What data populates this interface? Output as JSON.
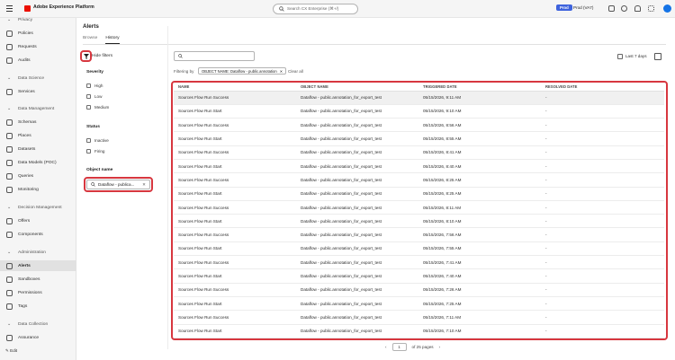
{
  "app": {
    "name": "Adobe Experience Platform",
    "search_placeholder": "Search CX Enterprise (⌘+/)",
    "env_badge": "Prod",
    "sandbox": "Prod (VA7)"
  },
  "sidebar": {
    "items": [
      {
        "label": "Privacy",
        "type": "section"
      },
      {
        "label": "Policies",
        "type": "item"
      },
      {
        "label": "Requests",
        "type": "item"
      },
      {
        "label": "Audits",
        "type": "item"
      },
      {
        "label": "Data Science",
        "type": "section"
      },
      {
        "label": "Services",
        "type": "item"
      },
      {
        "label": "Data Management",
        "type": "section"
      },
      {
        "label": "Schemas",
        "type": "item"
      },
      {
        "label": "Places",
        "type": "item"
      },
      {
        "label": "Datasets",
        "type": "item"
      },
      {
        "label": "Data Models (POC)",
        "type": "item"
      },
      {
        "label": "Queries",
        "type": "item"
      },
      {
        "label": "Monitoring",
        "type": "item"
      },
      {
        "label": "Decision Management",
        "type": "section"
      },
      {
        "label": "Offers",
        "type": "item"
      },
      {
        "label": "Components",
        "type": "item"
      },
      {
        "label": "Administration",
        "type": "section"
      },
      {
        "label": "Alerts",
        "type": "item",
        "active": true
      },
      {
        "label": "Sandboxes",
        "type": "item"
      },
      {
        "label": "Permissions",
        "type": "item"
      },
      {
        "label": "Tags",
        "type": "item"
      },
      {
        "label": "Data Collection",
        "type": "section"
      },
      {
        "label": "Assurance",
        "type": "item"
      }
    ],
    "edit": "Edit"
  },
  "page": {
    "title": "Alerts",
    "tabs": [
      "Browse",
      "History"
    ],
    "active_tab": "History"
  },
  "filters": {
    "hide_label": "Hide filters",
    "severity": {
      "title": "Severity",
      "options": [
        "High",
        "Low",
        "Medium"
      ]
    },
    "status": {
      "title": "Status",
      "options": [
        "Inactive",
        "Firing"
      ]
    },
    "object_name": {
      "title": "Object name",
      "value": "Dataflow - publica..."
    }
  },
  "toolbar": {
    "filtering_by": "Filtering by",
    "tag": "OBJECT NAME: Dataflow - public.annotation",
    "clear_all": "Clear all",
    "date_range": "Last 7 days"
  },
  "table": {
    "columns": [
      "NAME",
      "OBJECT NAME",
      "TRIGGERED DATE",
      "RESOLVED DATE"
    ],
    "rows": [
      [
        "Sources Flow Run Success",
        "Dataflow - public.annotation_for_export_test",
        "05/15/2026, 9:11 AM",
        "-"
      ],
      [
        "Sources Flow Run Start",
        "Dataflow - public.annotation_for_export_test",
        "05/15/2026, 9:10 AM",
        "-"
      ],
      [
        "Sources Flow Run Success",
        "Dataflow - public.annotation_for_export_test",
        "05/15/2026, 8:56 AM",
        "-"
      ],
      [
        "Sources Flow Run Start",
        "Dataflow - public.annotation_for_export_test",
        "05/15/2026, 8:55 AM",
        "-"
      ],
      [
        "Sources Flow Run Success",
        "Dataflow - public.annotation_for_export_test",
        "05/15/2026, 8:41 AM",
        "-"
      ],
      [
        "Sources Flow Run Start",
        "Dataflow - public.annotation_for_export_test",
        "05/15/2026, 8:40 AM",
        "-"
      ],
      [
        "Sources Flow Run Success",
        "Dataflow - public.annotation_for_export_test",
        "05/15/2026, 8:25 AM",
        "-"
      ],
      [
        "Sources Flow Run Start",
        "Dataflow - public.annotation_for_export_test",
        "05/15/2026, 8:25 AM",
        "-"
      ],
      [
        "Sources Flow Run Success",
        "Dataflow - public.annotation_for_export_test",
        "05/15/2026, 8:11 AM",
        "-"
      ],
      [
        "Sources Flow Run Start",
        "Dataflow - public.annotation_for_export_test",
        "05/15/2026, 8:10 AM",
        "-"
      ],
      [
        "Sources Flow Run Success",
        "Dataflow - public.annotation_for_export_test",
        "05/15/2026, 7:56 AM",
        "-"
      ],
      [
        "Sources Flow Run Start",
        "Dataflow - public.annotation_for_export_test",
        "05/15/2026, 7:55 AM",
        "-"
      ],
      [
        "Sources Flow Run Success",
        "Dataflow - public.annotation_for_export_test",
        "05/15/2026, 7:41 AM",
        "-"
      ],
      [
        "Sources Flow Run Start",
        "Dataflow - public.annotation_for_export_test",
        "05/15/2026, 7:40 AM",
        "-"
      ],
      [
        "Sources Flow Run Success",
        "Dataflow - public.annotation_for_export_test",
        "05/15/2026, 7:26 AM",
        "-"
      ],
      [
        "Sources Flow Run Start",
        "Dataflow - public.annotation_for_export_test",
        "05/15/2026, 7:25 AM",
        "-"
      ],
      [
        "Sources Flow Run Success",
        "Dataflow - public.annotation_for_export_test",
        "05/15/2026, 7:11 AM",
        "-"
      ],
      [
        "Sources Flow Run Start",
        "Dataflow - public.annotation_for_export_test",
        "05/15/2026, 7:10 AM",
        "-"
      ]
    ]
  },
  "pagination": {
    "page": "1",
    "of_pages": "of 25 pages"
  },
  "colors": {
    "highlight": "#d7373f",
    "brand": "#eb1000",
    "badge": "#3e63dd"
  }
}
